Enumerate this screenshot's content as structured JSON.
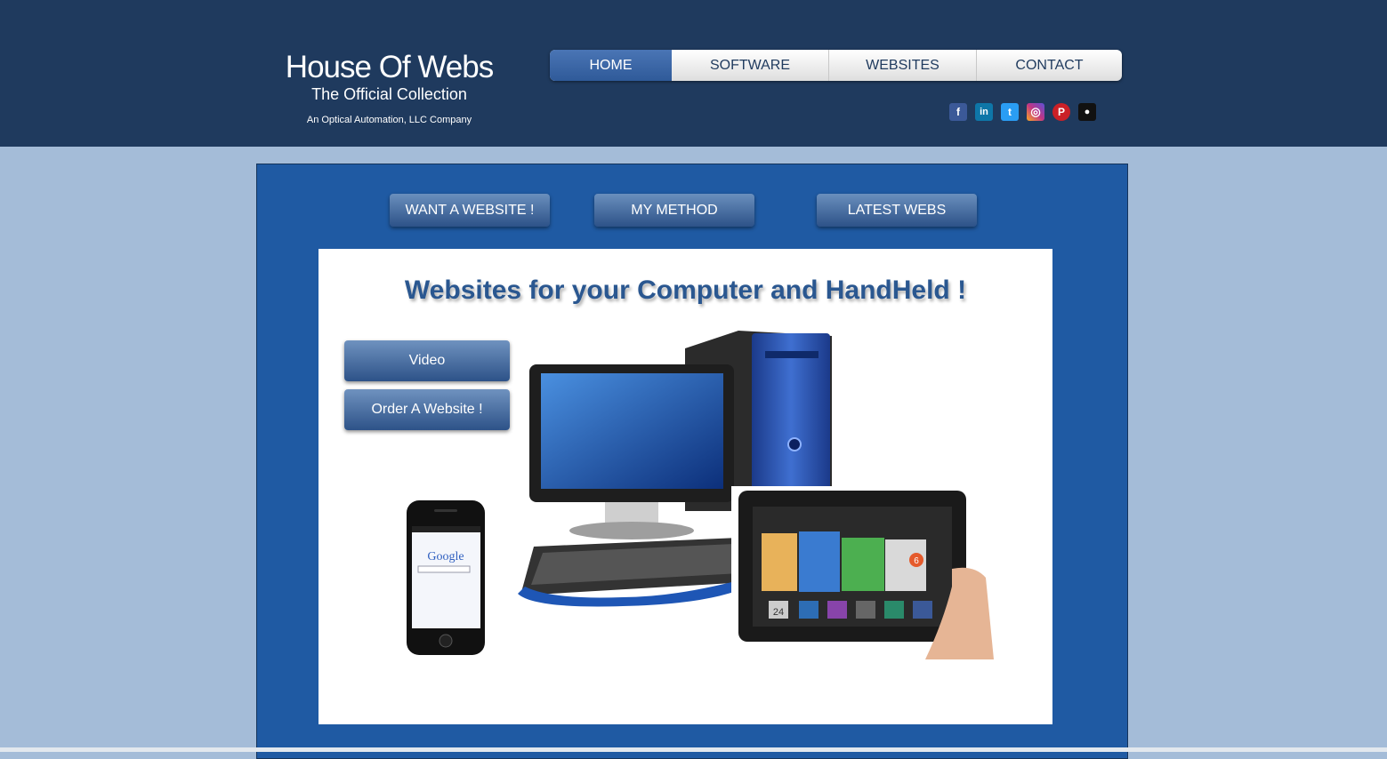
{
  "header": {
    "title": "House Of Webs",
    "subtitle": "The Official Collection",
    "company": "An Optical Automation, LLC Company"
  },
  "nav": {
    "items": [
      {
        "label": "HOME",
        "active": true
      },
      {
        "label": "SOFTWARE",
        "active": false
      },
      {
        "label": "WEBSITES",
        "active": false
      },
      {
        "label": "CONTACT",
        "active": false
      }
    ]
  },
  "social": {
    "icons": [
      {
        "name": "facebook-icon",
        "glyph": "f",
        "color": "#3b5998"
      },
      {
        "name": "linkedin-icon",
        "glyph": "in",
        "color": "#0e76a8"
      },
      {
        "name": "twitter-icon",
        "glyph": "t",
        "color": "#2a9df4"
      },
      {
        "name": "instagram-icon",
        "glyph": "◎",
        "color": "#c13584"
      },
      {
        "name": "pinterest-icon",
        "glyph": "P",
        "color": "#cb2027"
      },
      {
        "name": "github-icon",
        "glyph": "●",
        "color": "#111111"
      }
    ]
  },
  "main": {
    "top_buttons": [
      "WANT A WEBSITE !",
      "MY METHOD",
      "LATEST WEBS"
    ],
    "headline": "Websites for your Computer and HandHeld !",
    "side_buttons": [
      "Video",
      "Order A Website !"
    ],
    "phone_screen_text": "Google",
    "tablet_badge": "6",
    "tablet_date": "24"
  },
  "colors": {
    "header_bg": "#1f3a5e",
    "page_bg": "#a4bcd8",
    "panel_bg": "#1f5aa3",
    "accent": "#2a5790"
  }
}
